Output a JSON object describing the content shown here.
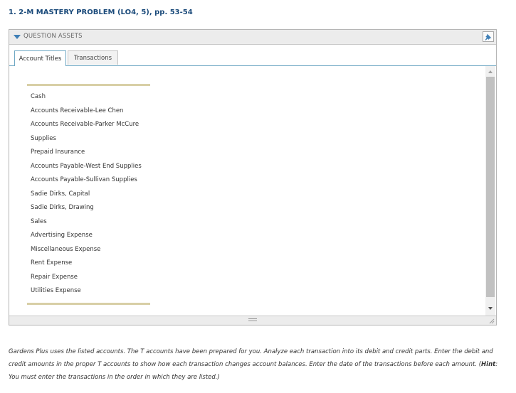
{
  "problem": {
    "title": "1. 2-M MASTERY PROBLEM (LO4, 5), pp. 53-54"
  },
  "assets_panel": {
    "header_label": "QUESTION ASSETS",
    "tabs": [
      {
        "label": "Account Titles",
        "active": true
      },
      {
        "label": "Transactions",
        "active": false
      }
    ],
    "accounts": [
      "Cash",
      "Accounts Receivable-Lee Chen",
      "Accounts Receivable-Parker McCure",
      "Supplies",
      "Prepaid Insurance",
      "Accounts Payable-West End Supplies",
      "Accounts Payable-Sullivan Supplies",
      "Sadie Dirks, Capital",
      "Sadie Dirks, Drawing",
      "Sales",
      "Advertising Expense",
      "Miscellaneous Expense",
      "Rent Expense",
      "Repair Expense",
      "Utilities Expense"
    ]
  },
  "instructions": {
    "text_before_hint": "Gardens Plus uses the listed accounts. The T accounts have been prepared for you. Analyze each transaction into its debit and credit parts. Enter the debit and credit amounts in the proper T accounts to show how each transaction changes account balances. Enter the date of the transactions before each amount. (",
    "hint_label": "Hint",
    "text_after_hint": ": You must enter the transactions in the order in which they are listed.)"
  },
  "colors": {
    "title": "#1a4a7a",
    "accent": "#3f7fb6",
    "tab_border": "#6fa8c4",
    "rule": "#d8cfa6"
  },
  "icons": {
    "collapse": "triangle-down-icon",
    "pin": "pin-icon",
    "scroll_up": "arrow-up-icon",
    "scroll_down": "arrow-down-icon",
    "resize": "grip-icon"
  }
}
